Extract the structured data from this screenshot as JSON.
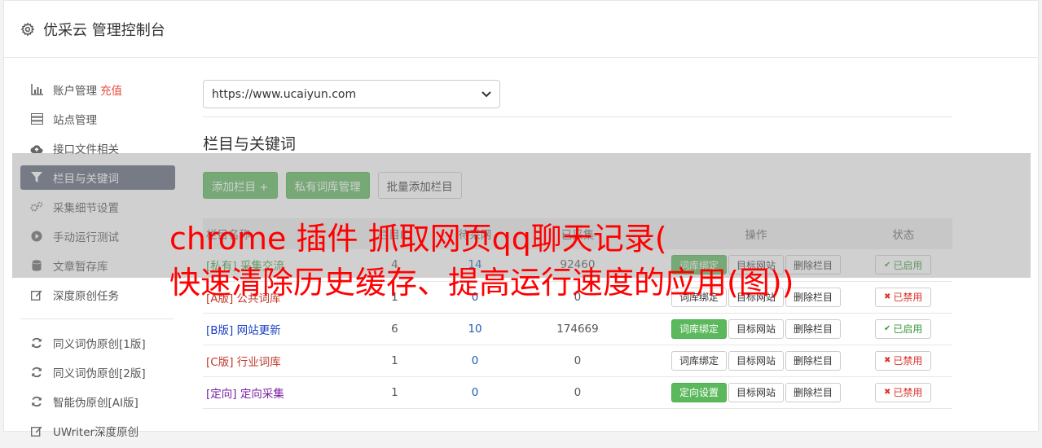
{
  "header": {
    "title": "优采云 管理控制台",
    "icon": "gear-icon"
  },
  "sidebar": {
    "items": [
      {
        "label": "账户管理",
        "extra": "充值",
        "icon": "bar-chart-icon"
      },
      {
        "label": "站点管理",
        "icon": "server-icon"
      },
      {
        "label": "接口文件相关",
        "icon": "cloud-upload-icon"
      },
      {
        "label": "栏目与关键词",
        "icon": "filter-icon",
        "active": true
      },
      {
        "label": "采集细节设置",
        "icon": "cogs-icon"
      },
      {
        "label": "手动运行测试",
        "icon": "play-circle-icon"
      },
      {
        "label": "文章暂存库",
        "icon": "database-icon"
      },
      {
        "label": "深度原创任务",
        "icon": "edit-icon"
      }
    ],
    "items2": [
      {
        "label": "同义词伪原创[1版]",
        "icon": "refresh-icon"
      },
      {
        "label": "同义词伪原创[2版]",
        "icon": "refresh-icon"
      },
      {
        "label": "智能伪原创[AI版]",
        "icon": "refresh-icon"
      },
      {
        "label": "UWriter深度原创",
        "icon": "edit-icon"
      }
    ]
  },
  "main": {
    "site_select": "https://www.ucaiyun.com",
    "section_title": "栏目与关键词",
    "buttons": {
      "add_column": "添加栏目 +",
      "private_lib": "私有词库管理",
      "batch_add": "批量添加栏目"
    },
    "table": {
      "headers": [
        "栏目名称",
        "栏目ID",
        "待采网",
        "已采集",
        "操作",
        "状态"
      ],
      "rows": [
        {
          "name": "[私有] 采集交流",
          "name_color": "#3a9a3a",
          "a": "4",
          "b": "14",
          "c": "92460",
          "op1": "词库绑定",
          "op1_green": true,
          "op2": "目标网站",
          "op3": "删除栏目",
          "status": "已启用",
          "enabled": true
        },
        {
          "name": "[A版] 公共词库",
          "name_color": "#c0392b",
          "a": "1",
          "b": "0",
          "c": "0",
          "op1": "词库绑定",
          "op1_green": false,
          "op2": "目标网站",
          "op3": "删除栏目",
          "status": "已禁用",
          "enabled": false
        },
        {
          "name": "[B版] 网站更新",
          "name_color": "#1a3fc7",
          "a": "6",
          "b": "10",
          "c": "174669",
          "op1": "词库绑定",
          "op1_green": true,
          "op2": "目标网站",
          "op3": "删除栏目",
          "status": "已启用",
          "enabled": true
        },
        {
          "name": "[C版] 行业词库",
          "name_color": "#c0392b",
          "a": "1",
          "b": "0",
          "c": "0",
          "op1": "词库绑定",
          "op1_green": false,
          "op2": "目标网站",
          "op3": "删除栏目",
          "status": "已禁用",
          "enabled": false
        },
        {
          "name": "[定向] 定向采集",
          "name_color": "#7b1fa2",
          "a": "1",
          "b": "0",
          "c": "0",
          "op1": "定向设置",
          "op1_green": true,
          "op2": "目标网站",
          "op3": "删除栏目",
          "status": "已禁用",
          "enabled": false
        }
      ]
    }
  },
  "overlay": {
    "line1": "chrome 插件 抓取网页qq聊天记录(",
    "line2": "快速清除历史缓存、提高运行速度的应用(图))"
  },
  "colors": {
    "active_nav": "#5b6577",
    "green": "#5cb85c",
    "red_text": "#ff0000"
  }
}
